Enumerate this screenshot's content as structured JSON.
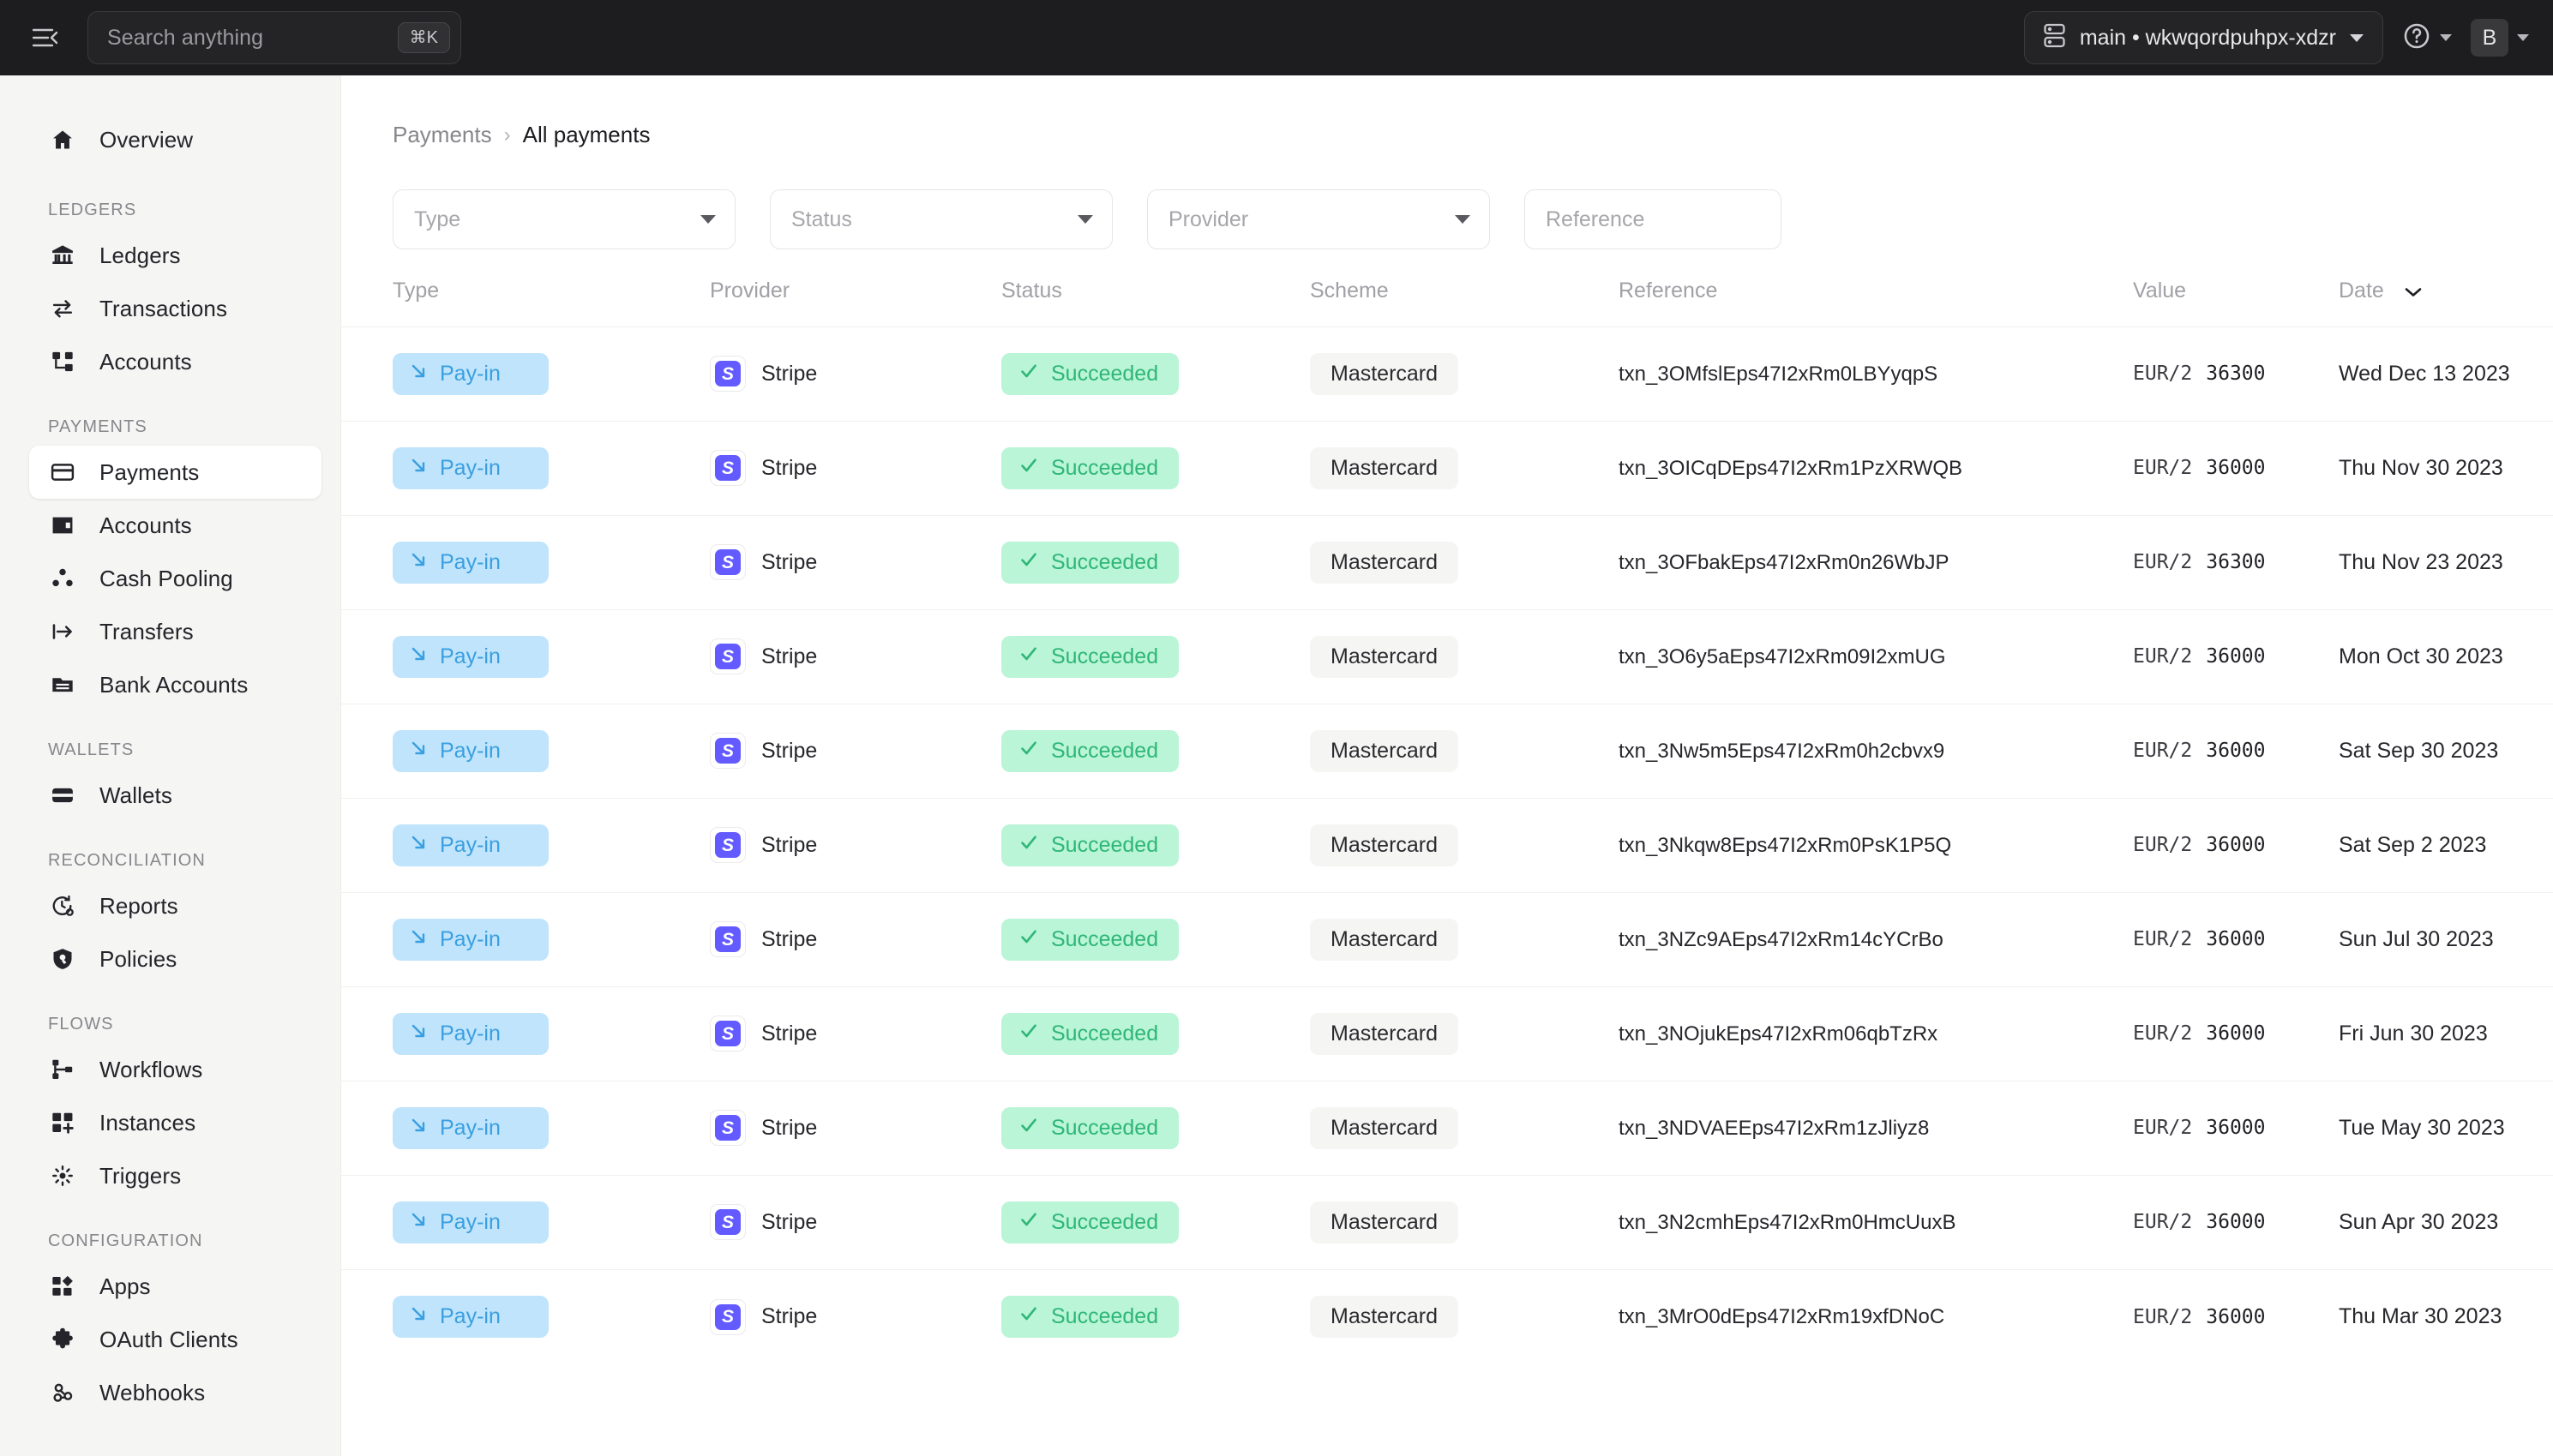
{
  "topbar": {
    "menu_icon": "hamburger-collapse-icon",
    "search_placeholder": "Search anything",
    "search_value": "",
    "search_shortcut": "⌘K",
    "env_icon": "stack-icon",
    "env_label": "main • wkwqordpuhpx-xdzr",
    "help_icon": "help-circle-icon",
    "avatar_initial": "B"
  },
  "sidebar": {
    "top": [
      {
        "label": "Overview",
        "icon": "home-icon",
        "active": false
      }
    ],
    "groups": [
      {
        "title": "LEDGERS",
        "items": [
          {
            "label": "Ledgers",
            "icon": "bank-icon",
            "active": false
          },
          {
            "label": "Transactions",
            "icon": "transfer-arrows-icon",
            "active": false
          },
          {
            "label": "Accounts",
            "icon": "hierarchy-icon",
            "active": false
          }
        ]
      },
      {
        "title": "PAYMENTS",
        "items": [
          {
            "label": "Payments",
            "icon": "credit-card-icon",
            "active": true
          },
          {
            "label": "Accounts",
            "icon": "wallet-card-icon",
            "active": false
          },
          {
            "label": "Cash Pooling",
            "icon": "dots-cluster-icon",
            "active": false
          },
          {
            "label": "Transfers",
            "icon": "arrow-right-bar-icon",
            "active": false
          },
          {
            "label": "Bank Accounts",
            "icon": "bank-folder-icon",
            "active": false
          }
        ]
      },
      {
        "title": "WALLETS",
        "items": [
          {
            "label": "Wallets",
            "icon": "wallet-icon",
            "active": false
          }
        ]
      },
      {
        "title": "RECONCILIATION",
        "items": [
          {
            "label": "Reports",
            "icon": "report-clock-icon",
            "active": false
          },
          {
            "label": "Policies",
            "icon": "shield-icon",
            "active": false
          }
        ]
      },
      {
        "title": "FLOWS",
        "items": [
          {
            "label": "Workflows",
            "icon": "workflow-icon",
            "active": false
          },
          {
            "label": "Instances",
            "icon": "grid-plus-icon",
            "active": false
          },
          {
            "label": "Triggers",
            "icon": "spark-icon",
            "active": false
          }
        ]
      },
      {
        "title": "CONFIGURATION",
        "items": [
          {
            "label": "Apps",
            "icon": "apps-icon",
            "active": false
          },
          {
            "label": "OAuth Clients",
            "icon": "puzzle-icon",
            "active": false
          },
          {
            "label": "Webhooks",
            "icon": "webhook-icon",
            "active": false
          }
        ]
      }
    ]
  },
  "breadcrumb": {
    "parent": "Payments",
    "separator": "›",
    "current": "All payments"
  },
  "filters": [
    {
      "name": "type",
      "placeholder": "Type",
      "value": "",
      "kind": "select"
    },
    {
      "name": "status",
      "placeholder": "Status",
      "value": "",
      "kind": "select"
    },
    {
      "name": "provider",
      "placeholder": "Provider",
      "value": "",
      "kind": "select"
    },
    {
      "name": "reference",
      "placeholder": "Reference",
      "value": "",
      "kind": "text"
    }
  ],
  "table": {
    "columns": [
      "Type",
      "Provider",
      "Status",
      "Scheme",
      "Reference",
      "Value",
      "Date"
    ],
    "sorted_column": "Date",
    "sort_icon": "chevron-down-icon",
    "row_action_icon": "chevron-right-icon",
    "rows": [
      {
        "type": "Pay-in",
        "provider": "Stripe",
        "status": "Succeeded",
        "scheme": "Mastercard",
        "reference": "txn_3OMfslEps47I2xRm0LBYyqpS",
        "currency": "EUR/2",
        "amount": "36300",
        "date": "Wed Dec 13 2023"
      },
      {
        "type": "Pay-in",
        "provider": "Stripe",
        "status": "Succeeded",
        "scheme": "Mastercard",
        "reference": "txn_3OICqDEps47I2xRm1PzXRWQB",
        "currency": "EUR/2",
        "amount": "36000",
        "date": "Thu Nov 30 2023"
      },
      {
        "type": "Pay-in",
        "provider": "Stripe",
        "status": "Succeeded",
        "scheme": "Mastercard",
        "reference": "txn_3OFbakEps47I2xRm0n26WbJP",
        "currency": "EUR/2",
        "amount": "36300",
        "date": "Thu Nov 23 2023"
      },
      {
        "type": "Pay-in",
        "provider": "Stripe",
        "status": "Succeeded",
        "scheme": "Mastercard",
        "reference": "txn_3O6y5aEps47I2xRm09I2xmUG",
        "currency": "EUR/2",
        "amount": "36000",
        "date": "Mon Oct 30 2023"
      },
      {
        "type": "Pay-in",
        "provider": "Stripe",
        "status": "Succeeded",
        "scheme": "Mastercard",
        "reference": "txn_3Nw5m5Eps47I2xRm0h2cbvx9",
        "currency": "EUR/2",
        "amount": "36000",
        "date": "Sat Sep 30 2023"
      },
      {
        "type": "Pay-in",
        "provider": "Stripe",
        "status": "Succeeded",
        "scheme": "Mastercard",
        "reference": "txn_3Nkqw8Eps47I2xRm0PsK1P5Q",
        "currency": "EUR/2",
        "amount": "36000",
        "date": "Sat Sep 2 2023"
      },
      {
        "type": "Pay-in",
        "provider": "Stripe",
        "status": "Succeeded",
        "scheme": "Mastercard",
        "reference": "txn_3NZc9AEps47I2xRm14cYCrBo",
        "currency": "EUR/2",
        "amount": "36000",
        "date": "Sun Jul 30 2023"
      },
      {
        "type": "Pay-in",
        "provider": "Stripe",
        "status": "Succeeded",
        "scheme": "Mastercard",
        "reference": "txn_3NOjukEps47I2xRm06qbTzRx",
        "currency": "EUR/2",
        "amount": "36000",
        "date": "Fri Jun 30 2023"
      },
      {
        "type": "Pay-in",
        "provider": "Stripe",
        "status": "Succeeded",
        "scheme": "Mastercard",
        "reference": "txn_3NDVAEEps47I2xRm1zJliyz8",
        "currency": "EUR/2",
        "amount": "36000",
        "date": "Tue May 30 2023"
      },
      {
        "type": "Pay-in",
        "provider": "Stripe",
        "status": "Succeeded",
        "scheme": "Mastercard",
        "reference": "txn_3N2cmhEps47I2xRm0HmcUuxB",
        "currency": "EUR/2",
        "amount": "36000",
        "date": "Sun Apr 30 2023"
      },
      {
        "type": "Pay-in",
        "provider": "Stripe",
        "status": "Succeeded",
        "scheme": "Mastercard",
        "reference": "txn_3MrO0dEps47I2xRm19xfDNoC",
        "currency": "EUR/2",
        "amount": "36000",
        "date": "Thu Mar 30 2023"
      }
    ]
  },
  "colors": {
    "topbar_bg": "#1d1d1f",
    "sidebar_bg": "#f5f5f4",
    "type_pill_bg": "#bfe4fb",
    "type_pill_fg": "#3a9fe0",
    "status_pill_bg": "#b9f5d6",
    "status_pill_fg": "#2fb678",
    "scheme_pill_bg": "#f5f5f3",
    "stripe_purple": "#635bff"
  }
}
